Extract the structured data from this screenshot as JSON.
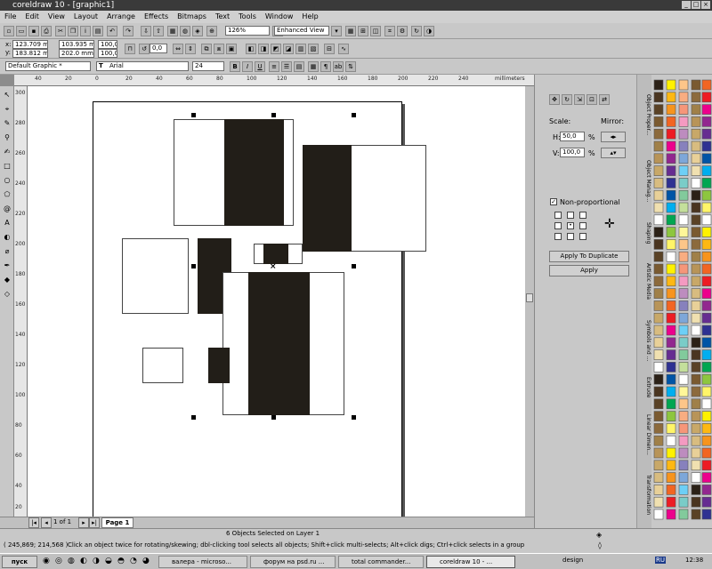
{
  "title": "coreldraw 10 - [graphic1]",
  "menu": [
    "File",
    "Edit",
    "View",
    "Layout",
    "Arrange",
    "Effects",
    "Bitmaps",
    "Text",
    "Tools",
    "Window",
    "Help"
  ],
  "toolbar": {
    "zoom": "126%",
    "view": "Enhanced View"
  },
  "propbar": {
    "x": "123.709 mm",
    "y": "183.812 mm",
    "w": "103.935 m",
    "h": "202.0 mm",
    "sx": "100,0",
    "sy": "100,0",
    "angle": "0,0"
  },
  "textbar": {
    "style": "Default Graphic *",
    "font": "Arial",
    "size": "24"
  },
  "ruler": {
    "unit": "millimeters",
    "top": [
      "40",
      "20",
      "0",
      "20",
      "40",
      "60",
      "80",
      "100",
      "120",
      "140",
      "160",
      "180",
      "200",
      "220",
      "240"
    ],
    "left": [
      "300",
      "280",
      "260",
      "240",
      "220",
      "200",
      "180",
      "160",
      "140",
      "120",
      "100",
      "80",
      "60",
      "40",
      "20"
    ]
  },
  "docker": {
    "scale": "Scale:",
    "mirror": "Mirror:",
    "h_label": "H:",
    "h_value": "50,0",
    "v_label": "V:",
    "v_value": "100,0",
    "pct": "%",
    "nonprop": "Non-proportional",
    "apply_dup": "Apply To Duplicate",
    "apply": "Apply"
  },
  "docker_tabs": [
    "Object Proper...",
    "Object Manag...",
    "Shaping",
    "Artistic Media",
    "Symbols and ...",
    "Extrude",
    "Linear Dimen...",
    "Transformation"
  ],
  "palette": {
    "col1": [
      "#2b2117",
      "#4a3520",
      "#5a4226",
      "#7a5a30",
      "#8c6a3c",
      "#a08048",
      "#b89458",
      "#c8a868",
      "#d8bc80",
      "#e8d098",
      "#f0e0b0",
      "#ffffff"
    ],
    "col2": [
      "#ffffff",
      "#fff200",
      "#fdb813",
      "#f7941d",
      "#f26522",
      "#ed1c24",
      "#ec008c",
      "#92278f",
      "#662d91",
      "#2e3192",
      "#0054a6",
      "#00aeef",
      "#00a651",
      "#8dc63f",
      "#fff568"
    ],
    "col3": [
      "#ffffff",
      "#fff799",
      "#fdc689",
      "#f9ad81",
      "#f69679",
      "#f49ac1",
      "#bd8cbf",
      "#8781bd",
      "#7da7d9",
      "#6dcff6",
      "#7accc8",
      "#82ca9c",
      "#c4df9b"
    ]
  },
  "page_nav": {
    "pos": "1 of 1",
    "tab": "Page 1"
  },
  "status": {
    "selection": "6 Objects Selected on Layer 1",
    "coords": "( 245,869; 214,568 )",
    "hint": "Click an object twice for rotating/skewing; dbl-clicking tool selects all objects; Shift+click multi-selects; Alt+click digs; Ctrl+click selects in a group"
  },
  "taskbar": {
    "start": "пуск",
    "tasks": [
      "валера - microso...",
      "форум на psd.ru ...",
      "total commander...",
      "coreldraw 10 - ..."
    ],
    "lang": "design",
    "locale": "RU",
    "clock": "12:38"
  }
}
